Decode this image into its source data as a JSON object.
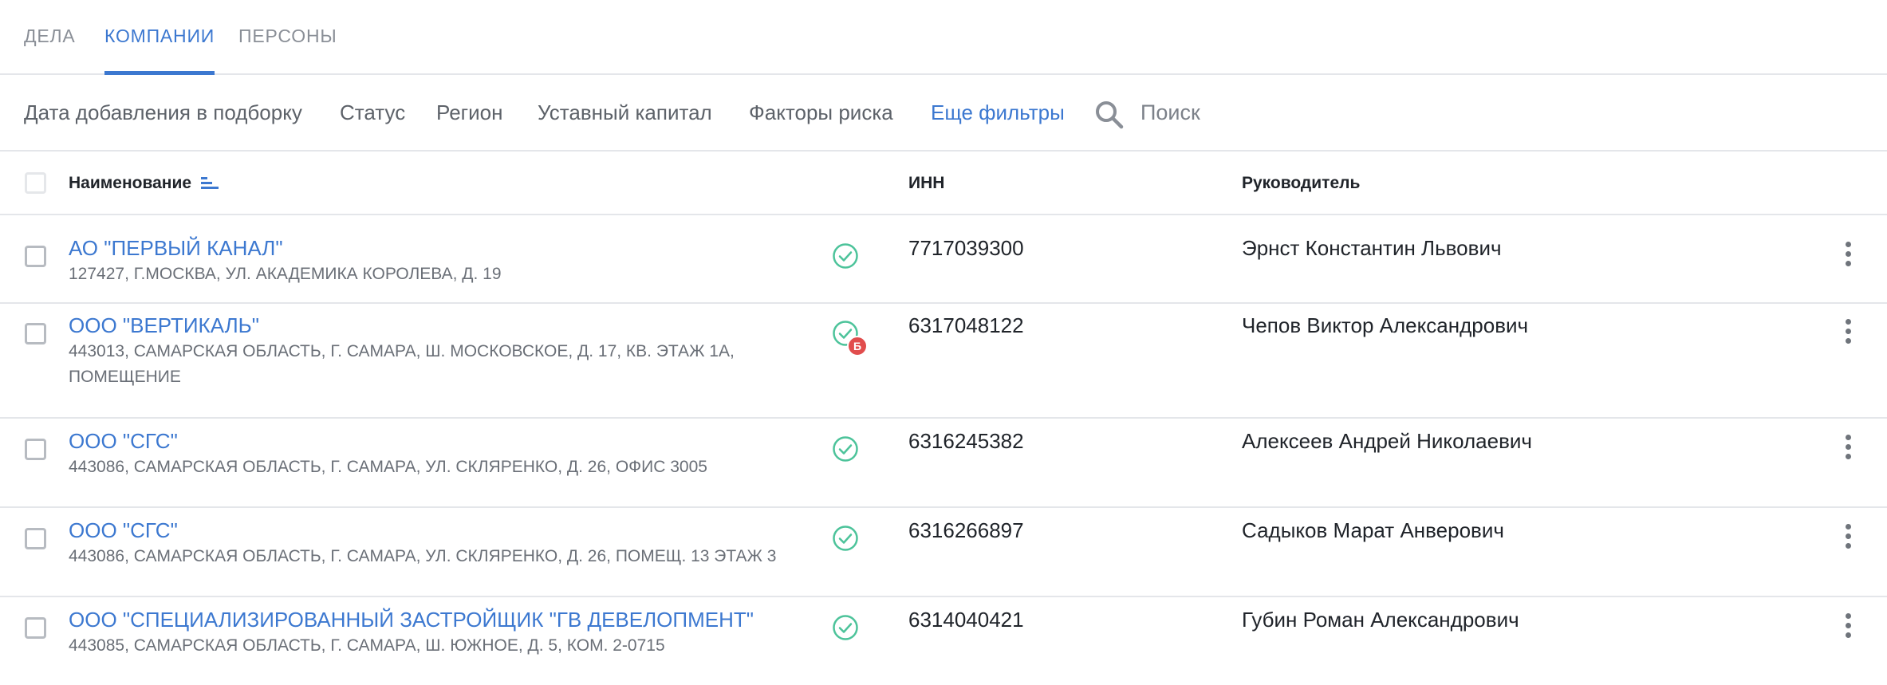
{
  "tabs": [
    {
      "label": "ДЕЛА",
      "active": false
    },
    {
      "label": "КОМПАНИИ",
      "active": true
    },
    {
      "label": "ПЕРСОНЫ",
      "active": false
    }
  ],
  "filters": {
    "items": [
      "Дата добавления в подборку",
      "Статус",
      "Регион",
      "Уставный капитал",
      "Факторы риска",
      "Еще фильтры"
    ],
    "search_label": "Поиск"
  },
  "table": {
    "columns": {
      "name": "Наименование",
      "inn": "ИНН",
      "head": "Руководитель"
    },
    "rows": [
      {
        "name": "АО \"ПЕРВЫЙ КАНАЛ\"",
        "address": "127427, Г.МОСКВА, УЛ. АКАДЕМИКА КОРОЛЕВА, Д. 19",
        "inn": "7717039300",
        "head": "Эрнст Константин Львович",
        "badge": ""
      },
      {
        "name": "ООО \"ВЕРТИКАЛЬ\"",
        "address": "443013, САМАРСКАЯ ОБЛАСТЬ, Г. САМАРА, Ш. МОСКОВСКОЕ, Д. 17, КВ. ЭТАЖ 1А, ПОМЕЩЕНИЕ",
        "inn": "6317048122",
        "head": "Чепов Виктор Александрович",
        "badge": "Б"
      },
      {
        "name": "ООО \"СГС\"",
        "address": "443086, САМАРСКАЯ ОБЛАСТЬ, Г. САМАРА, УЛ. СКЛЯРЕНКО, Д. 26, ОФИС 3005",
        "inn": "6316245382",
        "head": "Алексеев Андрей Николаевич",
        "badge": ""
      },
      {
        "name": "ООО \"СГС\"",
        "address": "443086, САМАРСКАЯ ОБЛАСТЬ, Г. САМАРА, УЛ. СКЛЯРЕНКО, Д. 26, ПОМЕЩ. 13 ЭТАЖ 3",
        "inn": "6316266897",
        "head": "Садыков Марат Анверович",
        "badge": ""
      },
      {
        "name": "ООО \"СПЕЦИАЛИЗИРОВАННЫЙ ЗАСТРОЙЩИК \"ГВ ДЕВЕЛОПМЕНТ\"",
        "address": "443085, САМАРСКАЯ ОБЛАСТЬ, Г. САМАРА, Ш. ЮЖНОЕ, Д. 5, КОМ. 2-0715",
        "inn": "6314040421",
        "head": "Губин Роман Александрович",
        "badge": ""
      }
    ]
  },
  "colors": {
    "accent": "#3c78d0",
    "status_ok": "#4cc39a",
    "badge": "#e14d4d"
  },
  "icons": {
    "sort": "sort-lines-icon",
    "search": "search-icon",
    "status": "check-circle-icon",
    "menu": "kebab-menu-icon"
  }
}
